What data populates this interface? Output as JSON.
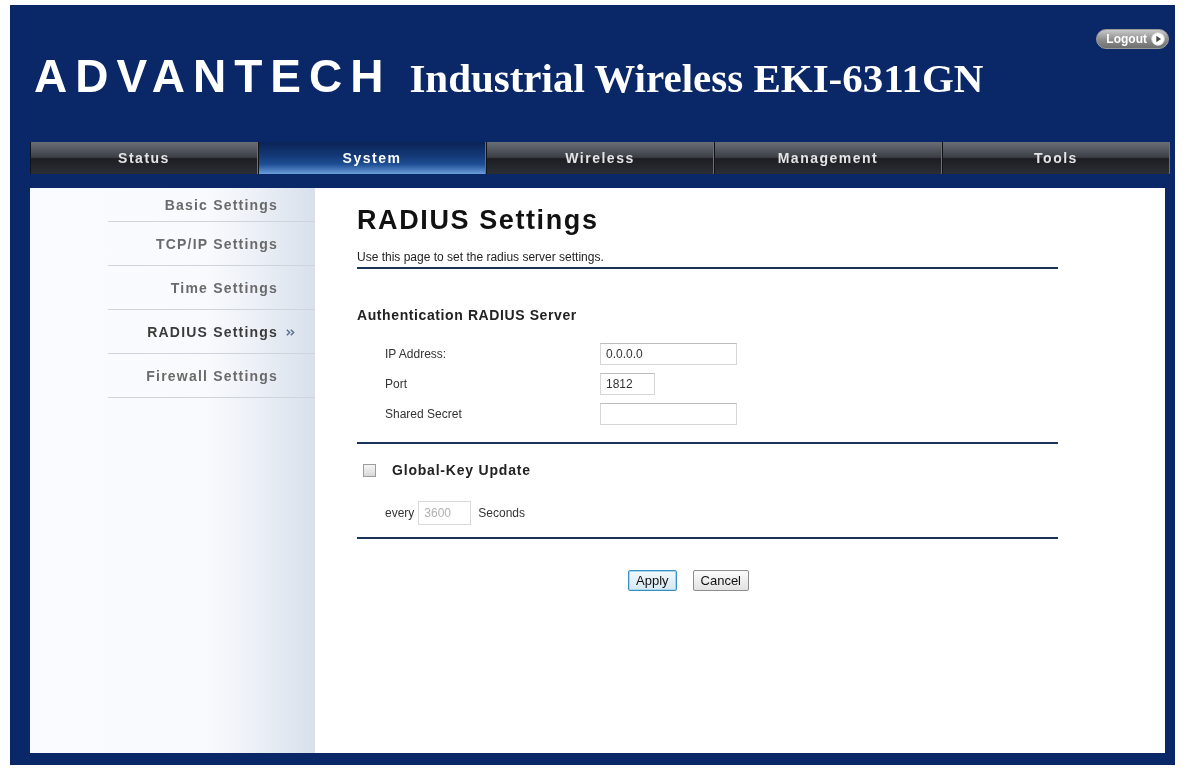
{
  "header": {
    "logo": "ADVANTECH",
    "title": "Industrial Wireless EKI-6311GN",
    "logout_button": "Logout"
  },
  "tabs": [
    {
      "label": "Status",
      "selected": false
    },
    {
      "label": "System",
      "selected": true
    },
    {
      "label": "Wireless",
      "selected": false
    },
    {
      "label": "Management",
      "selected": false
    },
    {
      "label": "Tools",
      "selected": false
    }
  ],
  "sidebar": {
    "items": [
      {
        "label": "Basic Settings",
        "selected": false
      },
      {
        "label": "TCP/IP Settings",
        "selected": false
      },
      {
        "label": "Time Settings",
        "selected": false
      },
      {
        "label": "RADIUS Settings",
        "selected": true
      },
      {
        "label": "Firewall Settings",
        "selected": false
      }
    ]
  },
  "content": {
    "title": "RADIUS Settings",
    "description": "Use this page to set the radius server settings.",
    "section": {
      "heading": "Authentication RADIUS Server",
      "fields": [
        {
          "label": "IP Address:",
          "value": "0.0.0.0"
        },
        {
          "label": "Port",
          "value": "1812"
        },
        {
          "label": "Shared Secret"
        }
      ]
    },
    "global_key_update": {
      "label": "Global-Key Update",
      "checked": false,
      "prefix": "every",
      "value": "3600",
      "suffix": "Seconds",
      "disabled": true
    },
    "buttons": [
      {
        "label": "Apply",
        "focused": true
      },
      {
        "label": "Cancel",
        "focused": false
      }
    ]
  }
}
